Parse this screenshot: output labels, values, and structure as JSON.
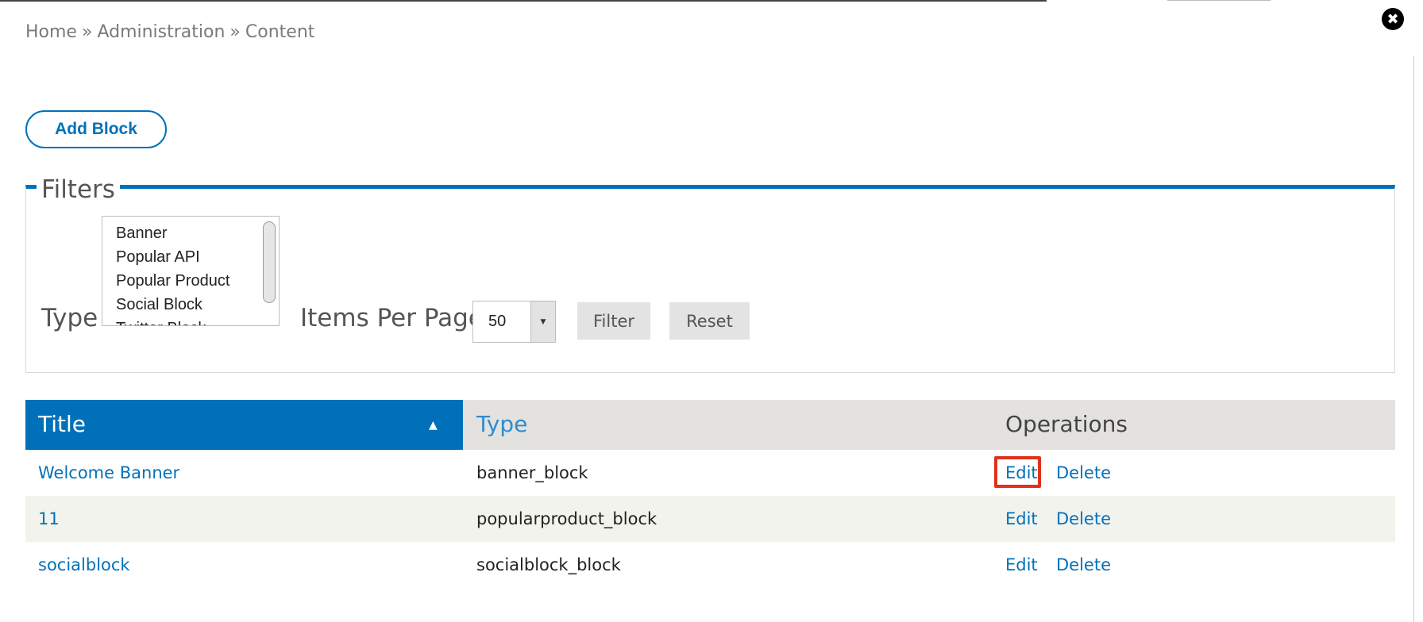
{
  "breadcrumb": {
    "home": "Home",
    "sep1": "»",
    "admin": "Administration",
    "sep2": "»",
    "content": "Content"
  },
  "close_glyph": "✖",
  "add_block_label": "Add Block",
  "filters": {
    "legend": "Filters",
    "type_label": "Type",
    "type_options": [
      "Banner",
      "Popular API",
      "Popular Product",
      "Social Block",
      "Twitter Block"
    ],
    "items_per_page_label": "Items Per Page",
    "items_per_page_value": "50",
    "filter_button": "Filter",
    "reset_button": "Reset"
  },
  "table": {
    "headers": {
      "title": "Title",
      "type": "Type",
      "operations": "Operations"
    },
    "rows": [
      {
        "title": "Welcome Banner",
        "type": "banner_block",
        "edit": "Edit",
        "delete": "Delete"
      },
      {
        "title": "11",
        "type": "popularproduct_block",
        "edit": "Edit",
        "delete": "Delete"
      },
      {
        "title": "socialblock",
        "type": "socialblock_block",
        "edit": "Edit",
        "delete": "Delete"
      }
    ]
  },
  "colors": {
    "accent": "#0071b9",
    "header_bg": "#e3e2de",
    "highlight": "#e0311c"
  },
  "icons": {
    "close": "close-icon",
    "sort": "sort-ascending-icon",
    "dropdown": "dropdown-arrow-icon"
  }
}
